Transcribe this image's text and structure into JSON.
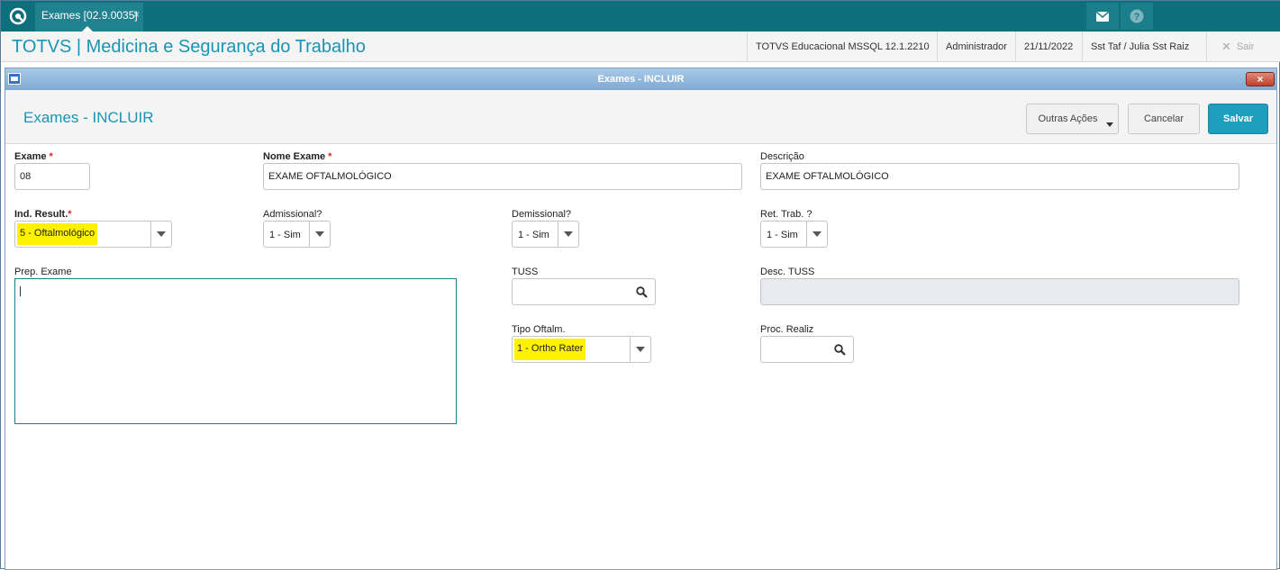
{
  "topbar": {
    "tab_label": "Exames [02.9.0035]",
    "tab_close": "×",
    "icons": [
      "mail-icon",
      "help-icon"
    ]
  },
  "header": {
    "app_title": "TOTVS | Medicina e Segurança do Trabalho",
    "environment": "TOTVS Educacional MSSQL 12.1.2210",
    "user": "Administrador",
    "date": "21/11/2022",
    "branch": "Sst Taf / Julia Sst Raiz",
    "exit_label": "Sair"
  },
  "dialog": {
    "window_title": "Exames - INCLUIR",
    "close_label": "×",
    "heading": "Exames - INCLUIR",
    "buttons": {
      "other_actions": "Outras Ações",
      "cancel": "Cancelar",
      "save": "Salvar"
    }
  },
  "form": {
    "exame": {
      "label": "Exame",
      "required": "*",
      "value": "08"
    },
    "nome_exame": {
      "label": "Nome Exame",
      "required": "*",
      "value": "EXAME OFTALMOLÓGICO"
    },
    "descricao": {
      "label": "Descrição",
      "value": "EXAME OFTALMOLÓGICO"
    },
    "ind_result": {
      "label": "Ind. Result.",
      "required": "*",
      "value": "5 - Oftalmológico",
      "highlighted": true
    },
    "admissional": {
      "label": "Admissional?",
      "value": "1 - Sim"
    },
    "demissional": {
      "label": "Demissional?",
      "value": "1 - Sim"
    },
    "ret_trab": {
      "label": "Ret. Trab. ?",
      "value": "1 - Sim"
    },
    "prep_exame": {
      "label": "Prep. Exame",
      "value": ""
    },
    "tuss": {
      "label": "TUSS",
      "value": ""
    },
    "desc_tuss": {
      "label": "Desc. TUSS",
      "value": ""
    },
    "tipo_oftalm": {
      "label": "Tipo Oftalm.",
      "value": "1 - Ortho Rater",
      "highlighted": true
    },
    "proc_realiz": {
      "label": "Proc. Realiz",
      "value": ""
    }
  },
  "colors": {
    "topbar": "#0e6f7c",
    "accent": "#1a94b5",
    "primary_button": "#1f9dbf",
    "highlight": "#fff200",
    "required": "#dd2222"
  }
}
